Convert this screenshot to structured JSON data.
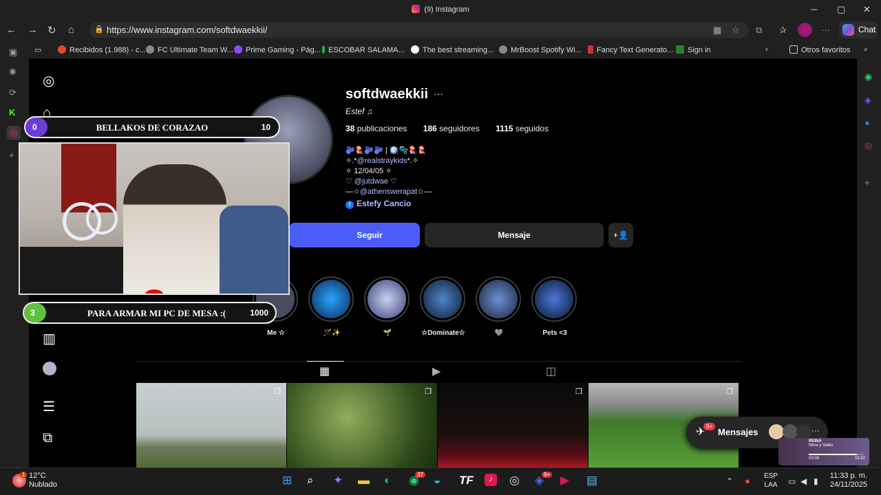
{
  "window": {
    "title": "(9) Instagram"
  },
  "browser": {
    "url": "https://www.instagram.com/softdwaekkii/",
    "chat_label": "Chat",
    "bookmarks": [
      {
        "label": "Recibidos (1.988) - c...",
        "color": "#ea4335"
      },
      {
        "label": "FC Ultimate Team W...",
        "color": "#888888"
      },
      {
        "label": "Prime Gaming - Pág...",
        "color": "#9146ff"
      },
      {
        "label": "ESCOBAR SALAMA...",
        "color": "#1db954"
      },
      {
        "label": "The best streaming...",
        "color": "#ffffff"
      },
      {
        "label": "MrBoost Spotify Wi...",
        "color": "#888888"
      },
      {
        "label": "Fancy Text Generato...",
        "color": "#d32f2f"
      },
      {
        "label": "Sign in",
        "color": "#2e7d32"
      },
      {
        "label": "Otros favoritos",
        "color": "#cccccc"
      }
    ]
  },
  "profile": {
    "username": "softdwaekkii",
    "full_name": "Estef ♫",
    "stats": {
      "posts_count": "38",
      "posts_label": "publicaciones",
      "followers_count": "186",
      "followers_label": "seguidores",
      "following_count": "1115",
      "following_label": "seguidos"
    },
    "bio": {
      "line1": "🫐🪼🫐🫐 | 🪩🫧🪼🪼",
      "line2_prefix": "✧.*",
      "line2_link": "@realstraykids",
      "line2_suffix": "*.✧",
      "line3": "✧ 12/04/05 ✧",
      "line4_prefix": "♡ ",
      "line4_link": "@jutdwae",
      "line4_suffix": " ♡",
      "line5_prefix": "—☆",
      "line5_link": "@athenswerapat",
      "line5_suffix": "☆—",
      "facebook": "Estefy Cancio"
    },
    "buttons": {
      "follow": "Seguir",
      "message": "Mensaje",
      "add_icon": "+👤"
    },
    "highlights": [
      {
        "label": "Me ☆",
        "color": "#4a4d60"
      },
      {
        "label": "🪄✨",
        "color": "#1a73e8"
      },
      {
        "label": "🌱",
        "color": "#6a7ca8"
      },
      {
        "label": "☆Dominate☆",
        "color": "#1d4e8f"
      },
      {
        "label": "🩶",
        "color": "#3b5998"
      },
      {
        "label": "Pets <3",
        "color": "#2a4c9a"
      }
    ]
  },
  "messages_pill": {
    "label": "Mensajes",
    "badge": "9+"
  },
  "overlay": {
    "goal_top": {
      "current": "0",
      "text": "BELLAKOS DE CORAZAO",
      "target": "10"
    },
    "goal_bottom": {
      "current": "3",
      "text": "PARA ARMAR MI PC DE MESA :(",
      "target": "1000"
    }
  },
  "mini_player": {
    "title": "REINA",
    "subtitle": "Mora y Saiko",
    "elapsed": "03:08",
    "total": "03:32"
  },
  "taskbar": {
    "temperature": "12°C",
    "condition": "Nublado",
    "weather_badge": "1",
    "language_1": "ESP",
    "language_2": "LAA",
    "time": "11:33 p. m.",
    "date": "24/11/2025",
    "whatsapp_badge": "37",
    "discord_badge": "9+"
  }
}
